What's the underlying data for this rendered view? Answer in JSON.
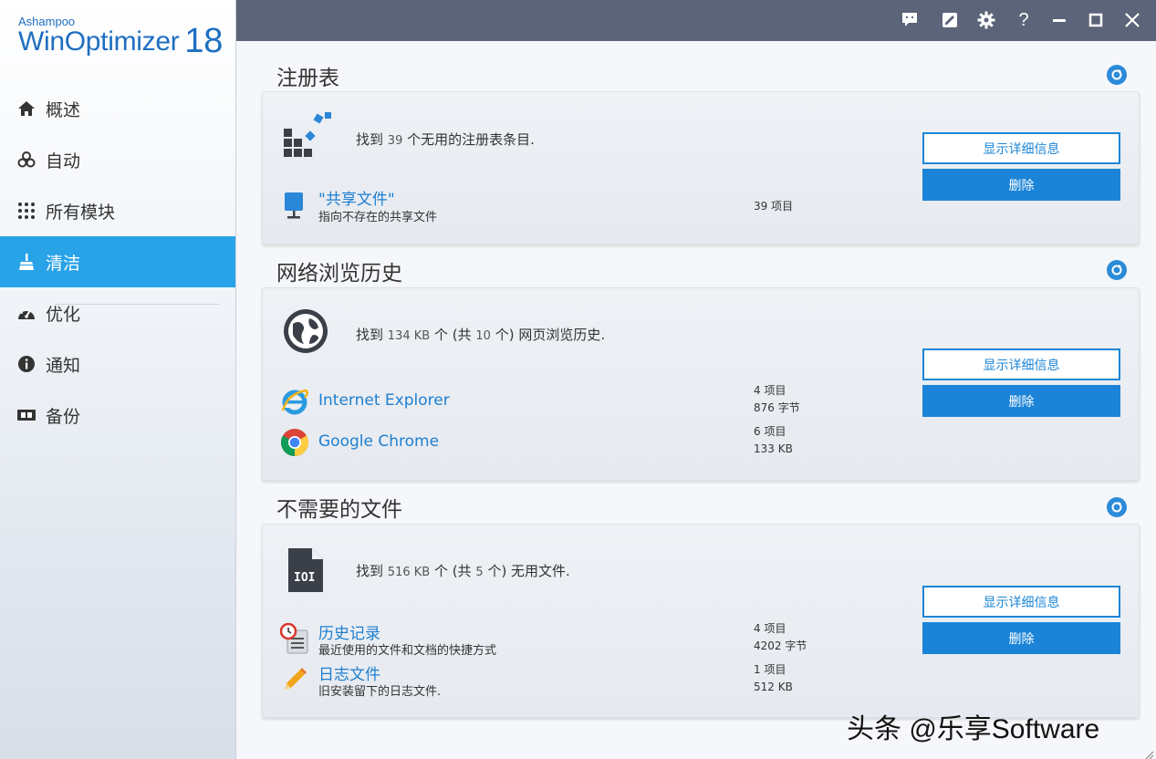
{
  "app": {
    "brand_sub": "Ashampoo",
    "brand_main": "WinOptimizer",
    "brand_version": "18"
  },
  "sidebar": {
    "items": [
      {
        "label": "概述",
        "icon": "home-icon"
      },
      {
        "label": "自动",
        "icon": "biohazard-icon"
      },
      {
        "label": "所有模块",
        "icon": "grid-icon"
      },
      {
        "label": "清洁",
        "icon": "broom-icon",
        "active": true
      },
      {
        "label": "优化",
        "icon": "speedometer-icon"
      },
      {
        "label": "通知",
        "icon": "info-icon"
      },
      {
        "label": "备份",
        "icon": "backup-icon"
      }
    ]
  },
  "titlebar": {
    "icons": [
      "chat-icon",
      "edit-icon",
      "gear-icon",
      "help-icon",
      "minimize-icon",
      "maximize-icon",
      "close-icon"
    ],
    "help_glyph": "?"
  },
  "sections": [
    {
      "title": "注册表",
      "summary_pre": "找到",
      "summary_num": "39",
      "summary_post": "个无用的注册表条目.",
      "details_label": "显示详细信息",
      "delete_label": "删除",
      "items": [
        {
          "name": "\"共享文件\"",
          "desc": "指向不存在的共享文件",
          "stat1": "39 项目",
          "stat2": ""
        }
      ]
    },
    {
      "title": "网络浏览历史",
      "summary_pre": "找到",
      "summary_num": "134 KB",
      "summary_mid": "个 (共",
      "summary_num2": "10",
      "summary_post": "个) 网页浏览历史.",
      "details_label": "显示详细信息",
      "delete_label": "删除",
      "items": [
        {
          "name": "Internet Explorer",
          "stat1": "4 项目",
          "stat2": "876 字节"
        },
        {
          "name": "Google Chrome",
          "stat1": "6 项目",
          "stat2": "133 KB"
        }
      ]
    },
    {
      "title": "不需要的文件",
      "summary_pre": "找到",
      "summary_num": "516 KB",
      "summary_mid": "个 (共",
      "summary_num2": "5",
      "summary_post": "个) 无用文件.",
      "details_label": "显示详细信息",
      "delete_label": "删除",
      "items": [
        {
          "name": "历史记录",
          "desc": "最近使用的文件和文档的快捷方式",
          "stat1": "4 项目",
          "stat2": "4202 字节"
        },
        {
          "name": "日志文件",
          "desc": "旧安装留下的日志文件.",
          "stat1": "1 项目",
          "stat2": "512 KB"
        }
      ]
    }
  ],
  "watermark": "头条 @乐享Software",
  "colors": {
    "accent": "#29a3e8",
    "button_blue": "#1b84d8",
    "titlebar": "#5b6478",
    "link": "#1e7fd0"
  }
}
